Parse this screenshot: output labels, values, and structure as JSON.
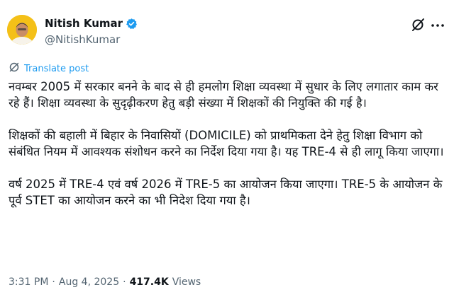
{
  "author": {
    "display_name": "Nitish Kumar",
    "handle": "@NitishKumar",
    "verified": true
  },
  "icons": {
    "verified": "verified-badge-icon",
    "grok": "grok-icon",
    "more": "more-options-icon",
    "translate": "translate-icon"
  },
  "colors": {
    "accent": "#1d9bf0",
    "muted": "#536471",
    "text": "#0f1419"
  },
  "translate": {
    "label": "Translate post"
  },
  "post": {
    "paragraphs": [
      "नवम्बर 2005 में सरकार बनने के बाद से ही हमलोग शिक्षा व्यवस्था में सुधार के लिए लगातार काम कर रहे हैं। शिक्षा व्यवस्था के सुदृढ़ीकरण हेतु बड़ी संख्या में शिक्षकों की नियुक्ति की गई है।",
      "शिक्षकों की बहाली में बिहार के निवासियों (DOMICILE) को प्राथमिकता देने हेतु शिक्षा विभाग को संबंधित नियम में आवश्यक संशोधन करने का निर्देश दिया गया है। यह TRE-4 से ही लागू किया जाएगा।",
      "वर्ष 2025 में TRE-4 एवं वर्ष 2026 में TRE-5 का आयोजन किया जाएगा। TRE-5 के आयोजन के पूर्व STET का आयोजन करने का भी निदेश दिया गया है।"
    ]
  },
  "meta": {
    "time": "3:31 PM",
    "separator": "·",
    "date": "Aug 4, 2025",
    "views_count": "417.4K",
    "views_label": "Views"
  }
}
